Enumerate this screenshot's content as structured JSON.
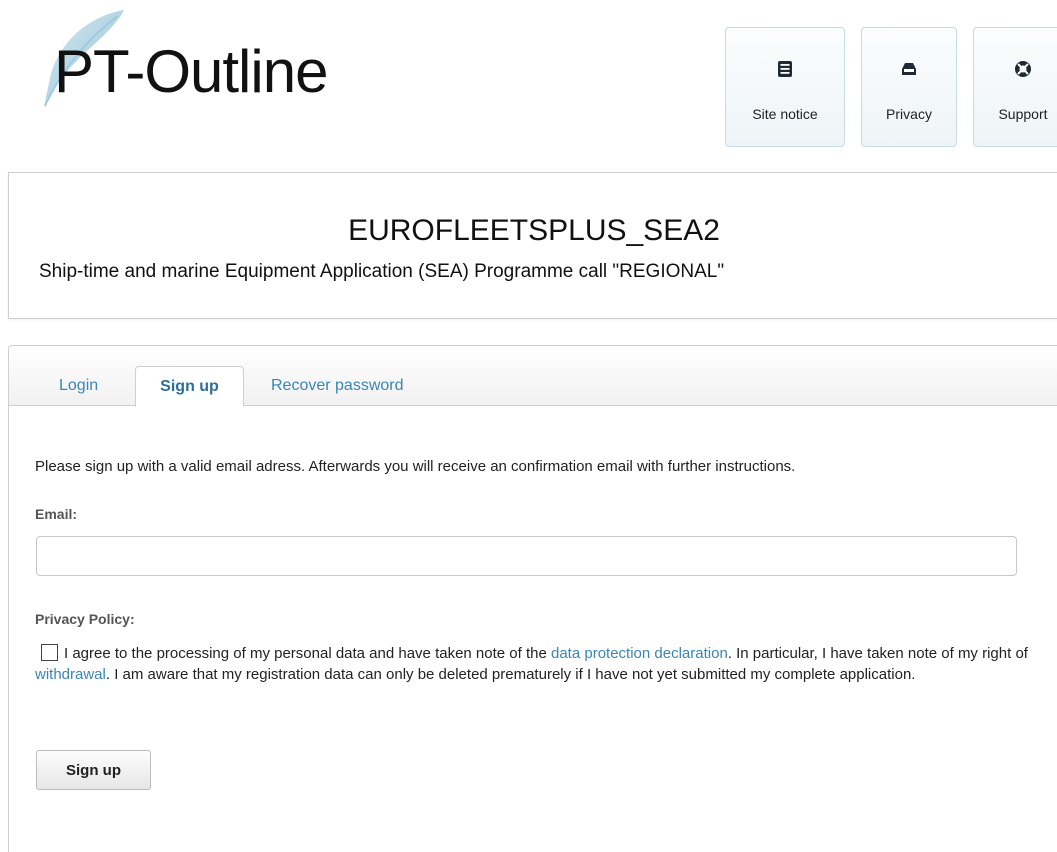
{
  "logo": {
    "text": "PT-Outline"
  },
  "top_nav": [
    {
      "label": "Site notice",
      "icon": "site-notice-icon"
    },
    {
      "label": "Privacy",
      "icon": "privacy-icon"
    },
    {
      "label": "Support",
      "icon": "support-icon"
    }
  ],
  "header": {
    "title": "EUROFLEETSPLUS_SEA2",
    "subtitle": "Ship-time and marine Equipment Application (SEA) Programme call \"REGIONAL\""
  },
  "tabs": [
    {
      "label": "Login",
      "active": false
    },
    {
      "label": "Sign up",
      "active": true
    },
    {
      "label": "Recover password",
      "active": false
    }
  ],
  "form": {
    "intro": "Please sign up with a valid email adress. Afterwards you will receive an confirmation email with further instructions.",
    "email_label": "Email:",
    "email_value": "",
    "privacy_label": "Privacy Policy:",
    "privacy_text_1": "I agree to the processing of my personal data and have taken note of the ",
    "privacy_link_1": "data protection declaration",
    "privacy_text_2": ". In particular, I have taken note of my right of ",
    "privacy_link_2": "withdrawal",
    "privacy_text_3": ". I am aware that my registration data can only be deleted prematurely if I have not yet submitted my complete application.",
    "privacy_checked": false,
    "submit_label": "Sign up"
  },
  "colors": {
    "link": "#3a86b4",
    "border": "#cfcfcf",
    "button_border": "#c7dbe3"
  }
}
